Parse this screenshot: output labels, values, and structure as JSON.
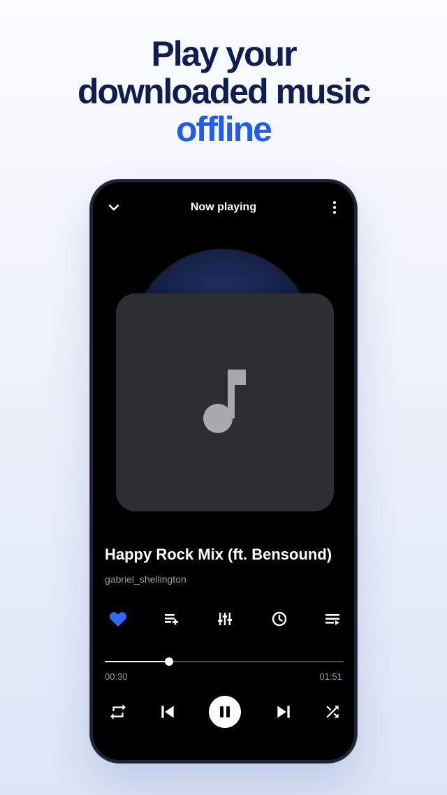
{
  "headline": {
    "line1": "Play your",
    "line2": "downloaded music",
    "line3": "offline"
  },
  "colors": {
    "accent": "#1f5cf2",
    "headline_dark": "#0f1d4f",
    "favorite": "#2f6bf0",
    "artwork_bg": "#2d2e31"
  },
  "player": {
    "header_title": "Now playing",
    "song_title": "Happy Rock Mix (ft. Bensound)",
    "artist": "gabriel_shellington",
    "elapsed": "00:30",
    "duration": "01:51",
    "progress": 0.27,
    "favorited": true
  },
  "icons": {
    "header": [
      "chevron-down-icon",
      "more-vertical-icon"
    ],
    "artwork": "music-note-icon",
    "actions": [
      "heart-icon",
      "add-to-playlist-icon",
      "equalizer-icon",
      "sleep-timer-icon",
      "queue-icon"
    ],
    "controls": [
      "repeat-icon",
      "previous-icon",
      "pause-icon",
      "next-icon",
      "shuffle-icon"
    ]
  }
}
